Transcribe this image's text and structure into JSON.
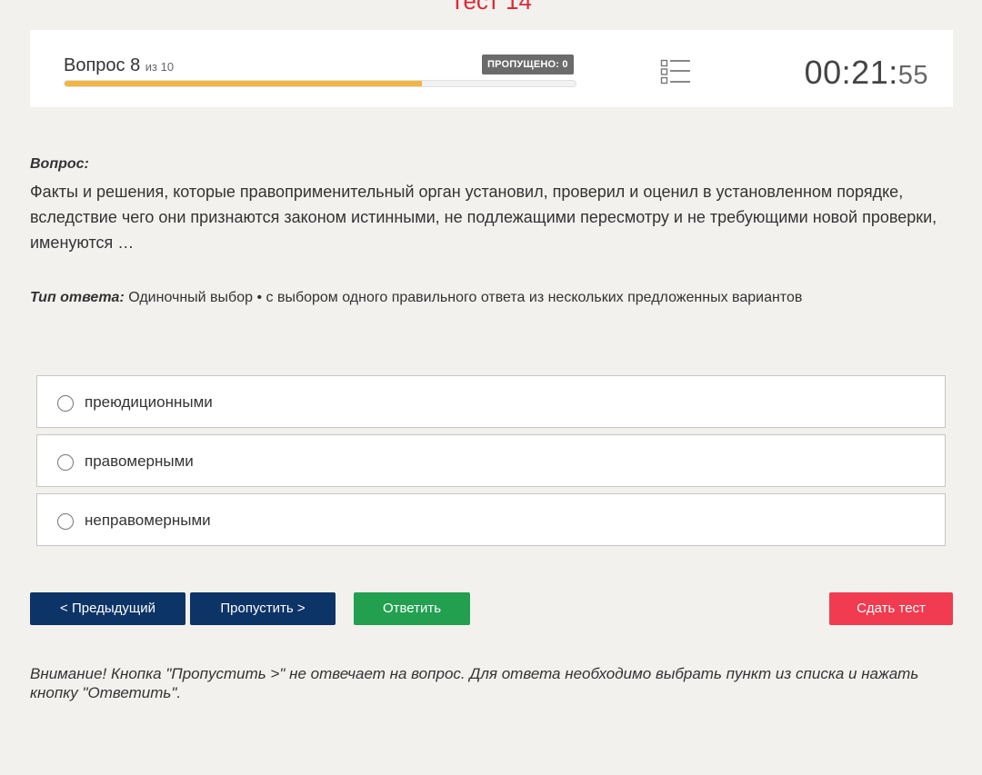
{
  "header": {
    "title": "Тест 14"
  },
  "status": {
    "question_prefix": "Вопрос",
    "question_number": "8",
    "question_of": "из 10",
    "skipped_badge": "ПРОПУЩЕНО: 0",
    "progress_fraction": 0.7,
    "timer_main": "00:21:",
    "timer_seconds": "55"
  },
  "question": {
    "label": "Вопрос:",
    "text": "Факты и решения, которые правоприменительный орган установил, проверил и оценил в установленном порядке, вследствие чего они признаются законом истинными, не подлежащими пересмотру и не требующими новой проверки, именуются …",
    "answer_type_label": "Тип ответа:",
    "answer_type_value": "Одиночный выбор • с выбором одного правильного ответа из нескольких предложенных вариантов"
  },
  "options": [
    {
      "label": "преюдиционными"
    },
    {
      "label": "правомерными"
    },
    {
      "label": "неправомерными"
    }
  ],
  "buttons": {
    "prev": "< Предыдущий",
    "skip": "Пропустить >",
    "answer": "Ответить",
    "submit": "Сдать тест"
  },
  "notice": "Внимание! Кнопка \"Пропустить >\" не отвечает на вопрос. Для ответа необходимо выбрать пункт из списка и нажать кнопку \"Ответить\".",
  "colors": {
    "title_red": "#d92b3a",
    "navy": "#0d3466",
    "green": "#22a050",
    "red_button": "#f03b50",
    "progress_orange": "#f0b643"
  },
  "icons": {
    "question_list": "list-icon"
  }
}
